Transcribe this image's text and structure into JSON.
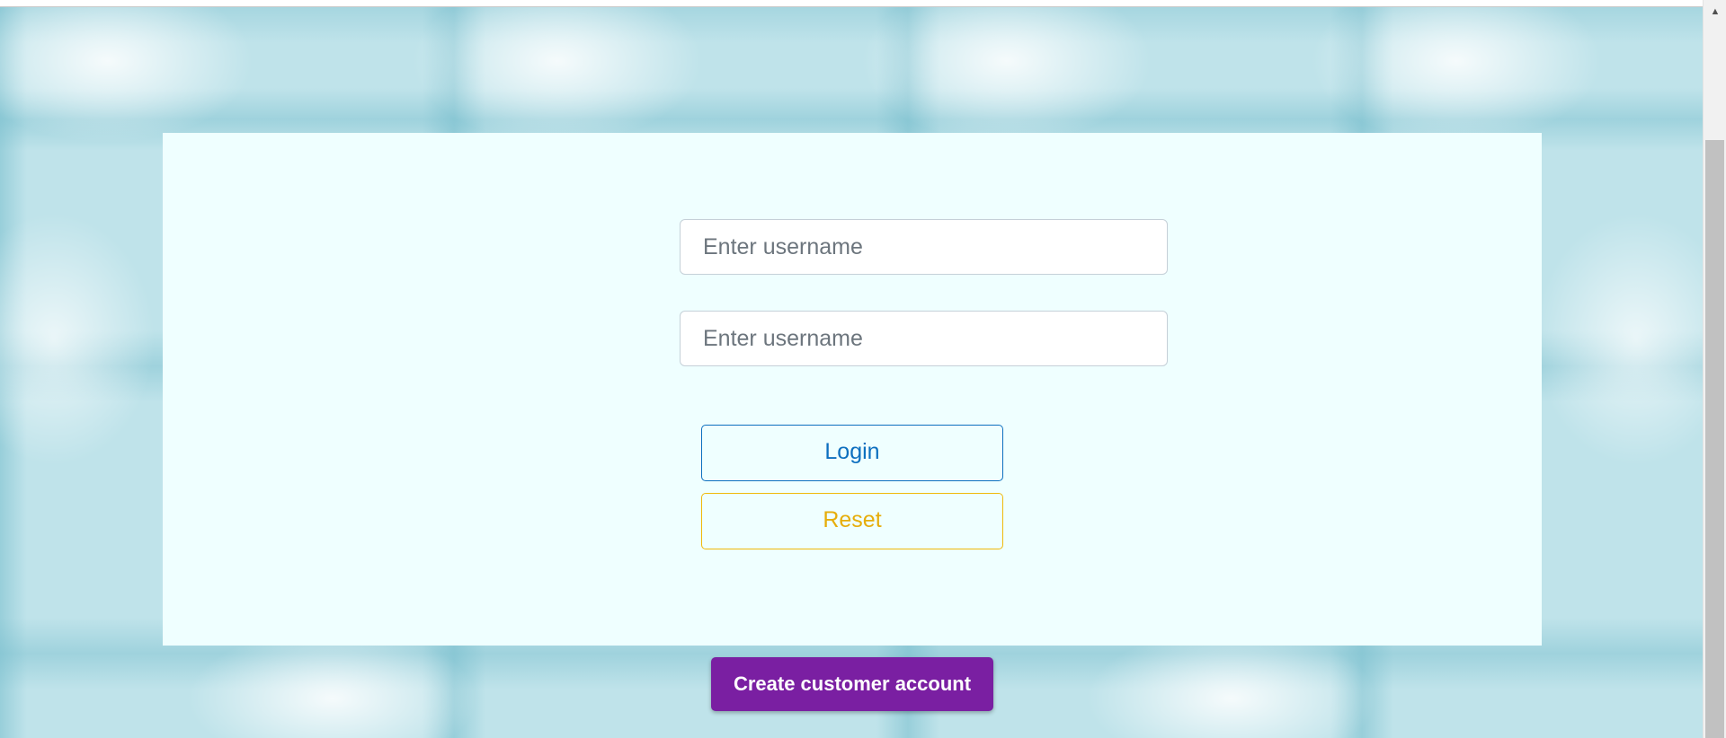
{
  "form": {
    "username_placeholder": "Enter username",
    "password_placeholder": "Enter username",
    "username_value": "",
    "password_value": ""
  },
  "buttons": {
    "login_label": "Login",
    "reset_label": "Reset",
    "create_account_label": "Create customer account"
  },
  "icons": {
    "scroll_up": "scroll-up-arrow-icon"
  },
  "colors": {
    "card_background": "#efffff",
    "login_accent": "#0d6fbf",
    "reset_accent": "#f0b90b",
    "create_account_background": "#7a1fa2"
  }
}
